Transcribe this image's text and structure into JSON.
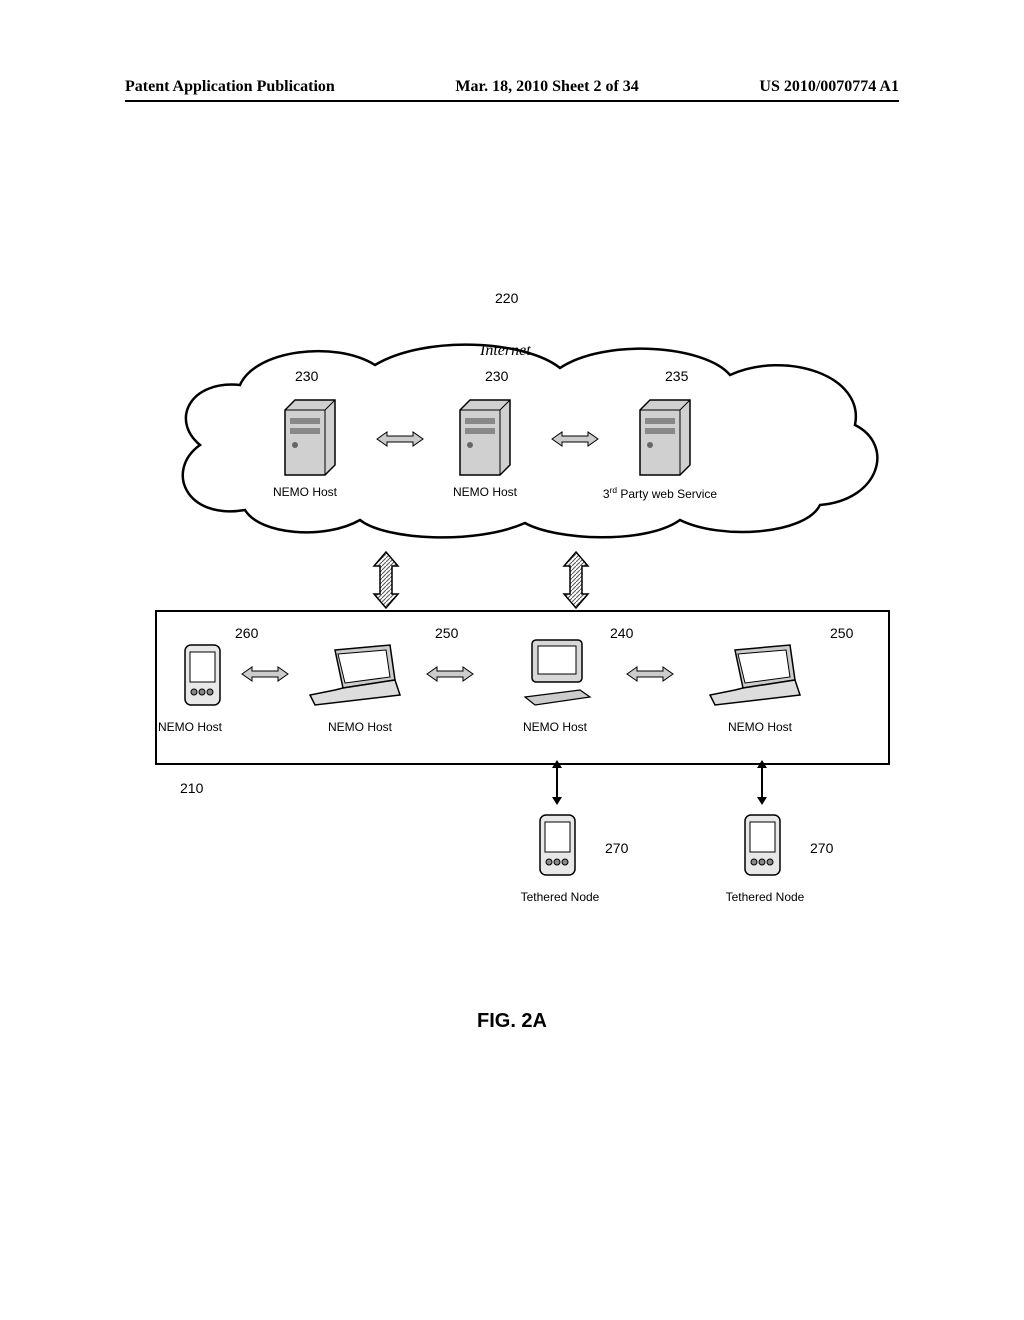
{
  "header": {
    "left": "Patent Application Publication",
    "center": "Mar. 18, 2010  Sheet 2 of 34",
    "right": "US 2010/0070774 A1"
  },
  "figure": {
    "caption": "FIG. 2A",
    "cloud_label": "Internet",
    "refs": {
      "cloud": "220",
      "server_left": "230",
      "server_mid": "230",
      "server_right": "235",
      "pda_tl": "260",
      "laptop_l": "250",
      "desktop": "240",
      "laptop_r": "250",
      "box": "210",
      "tether_l": "270",
      "tether_r": "270"
    },
    "labels": {
      "nemo_host": "NEMO Host",
      "third_party_prefix": "3",
      "third_party_ord": "rd",
      "third_party_suffix": " Party web Service",
      "tethered": "Tethered Node"
    }
  }
}
